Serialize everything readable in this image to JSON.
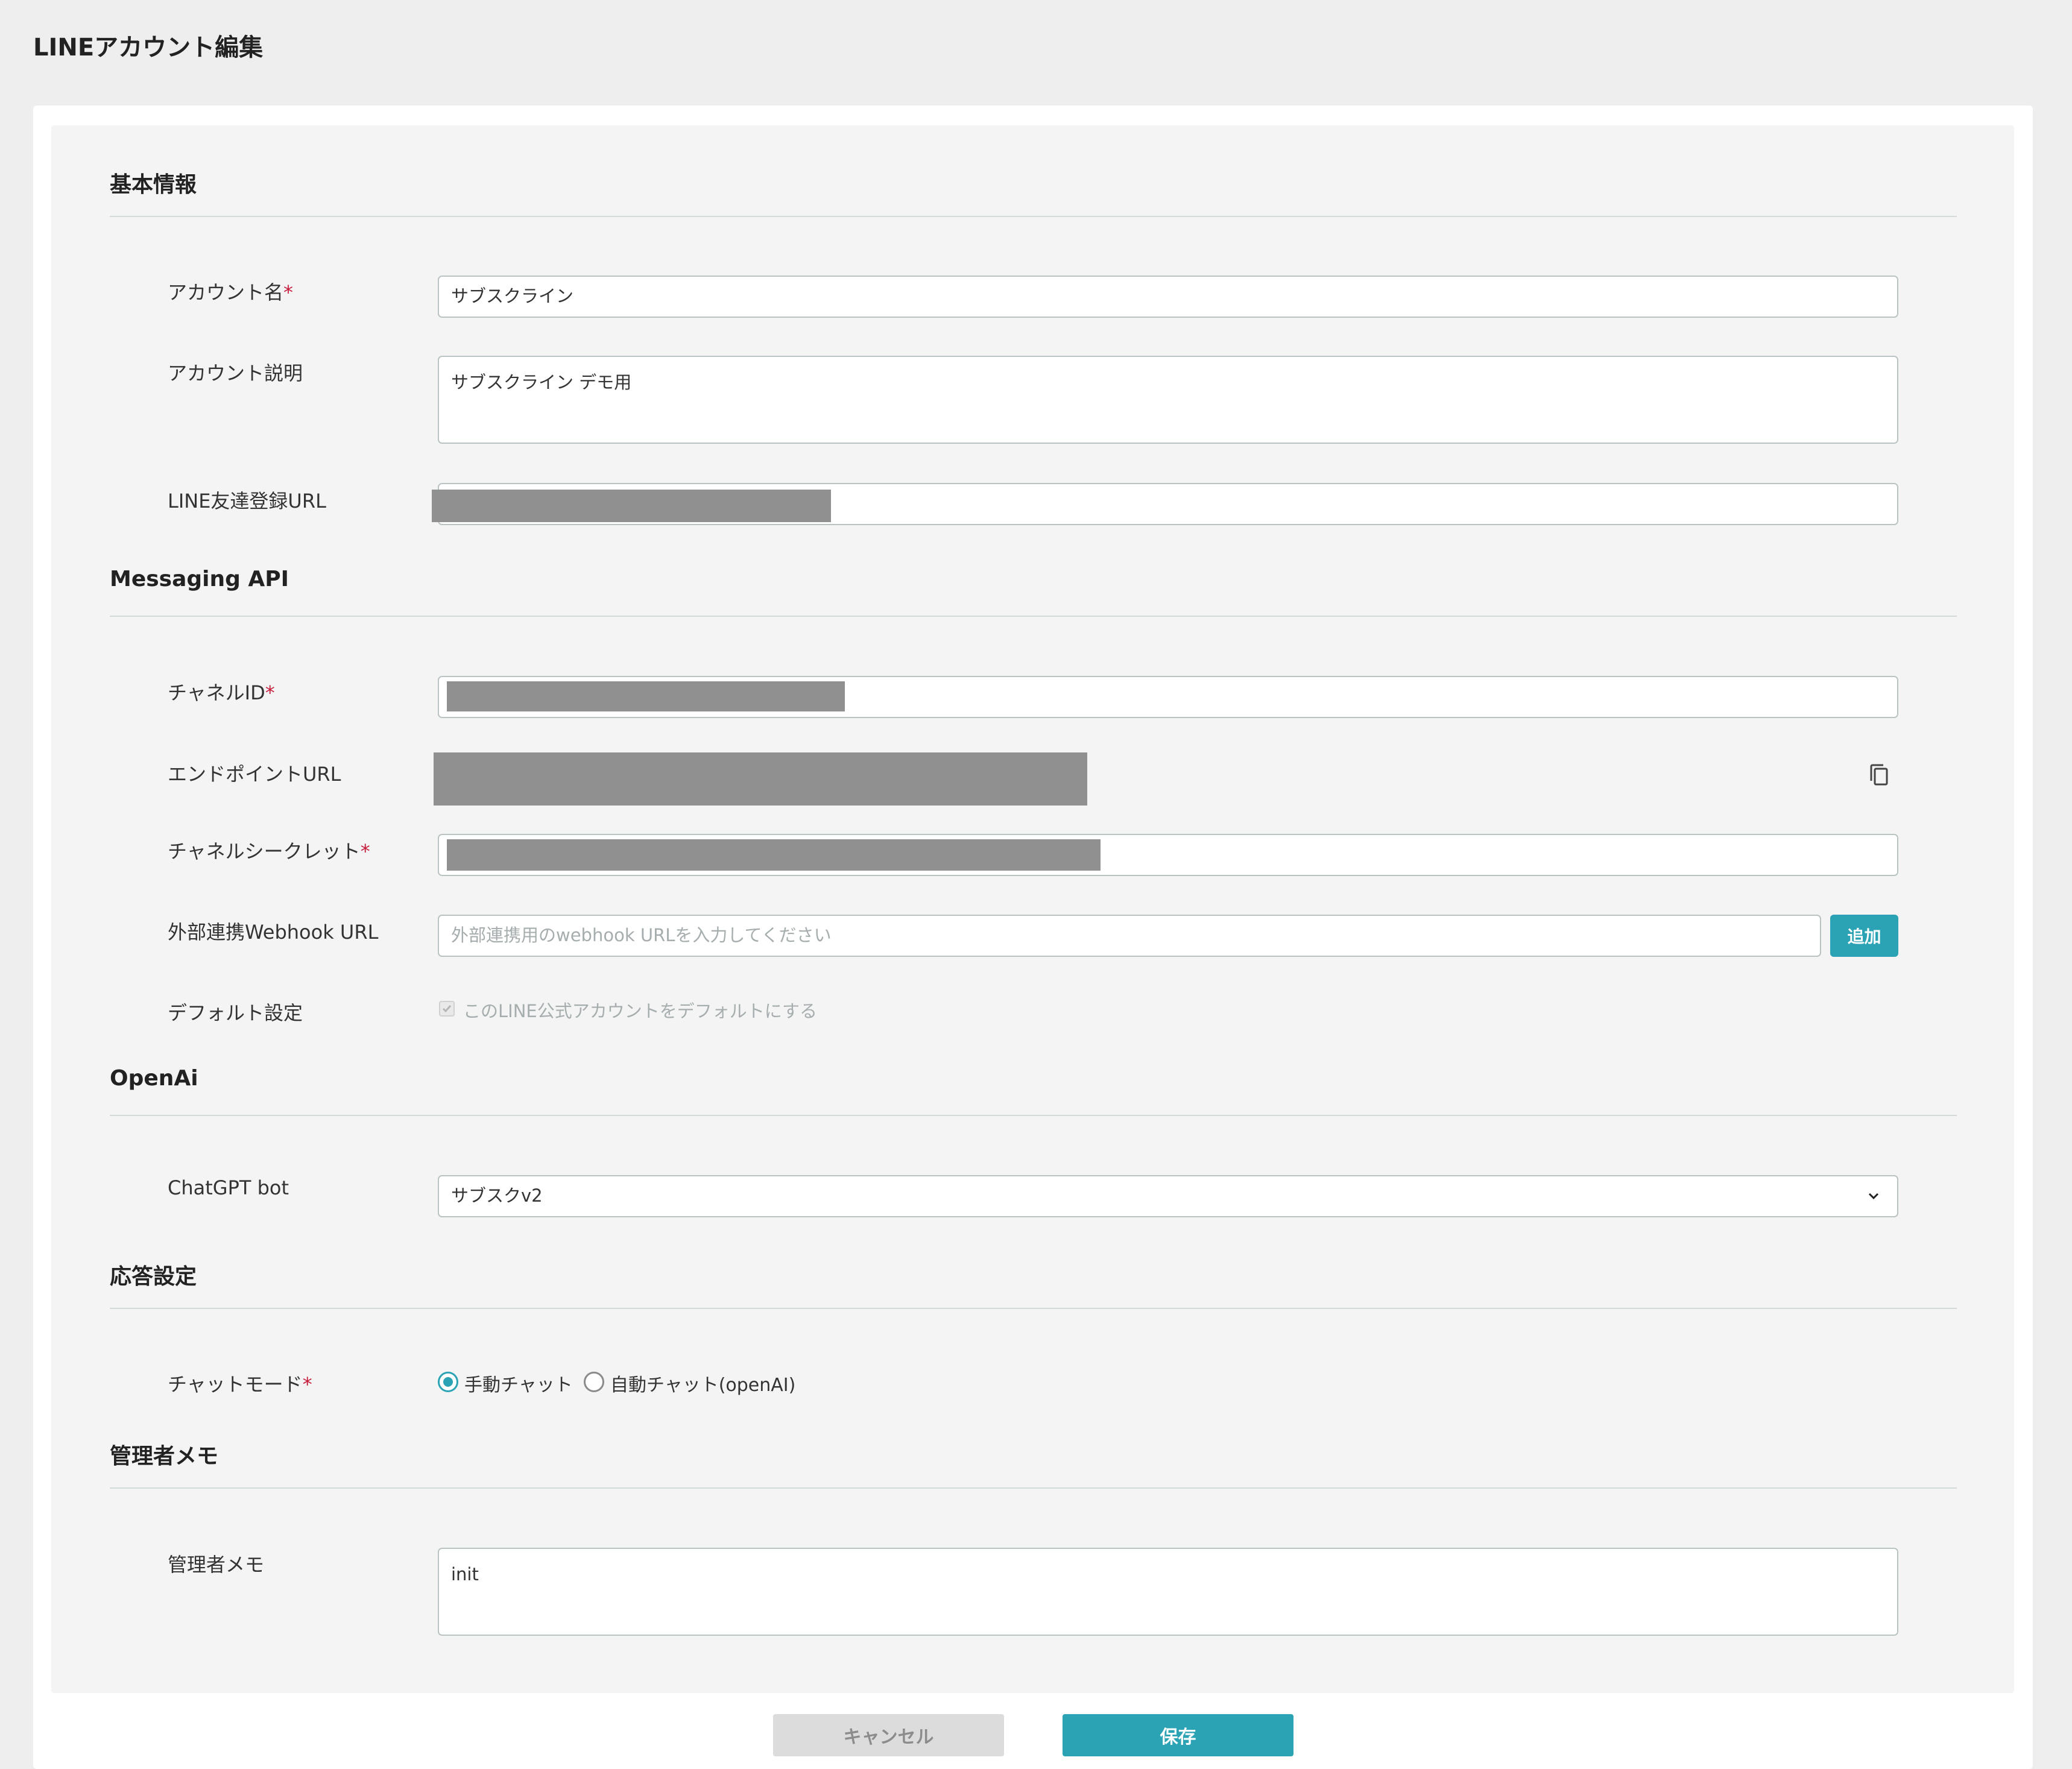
{
  "page": {
    "title": "LINEアカウント編集"
  },
  "basic": {
    "title": "基本情報",
    "account_name": {
      "label": "アカウント名",
      "required": "*",
      "value": "サブスクライン"
    },
    "account_desc": {
      "label": "アカウント説明",
      "value": "サブスクライン デモ用"
    },
    "friend_url": {
      "label": "LINE友達登録URL"
    }
  },
  "messaging": {
    "title": "Messaging API",
    "channel_id": {
      "label": "チャネルID",
      "required": "*"
    },
    "endpoint_url": {
      "label": "エンドポイントURL"
    },
    "channel_secret": {
      "label": "チャネルシークレット",
      "required": "*"
    },
    "webhook": {
      "label": "外部連携Webhook URL",
      "placeholder": "外部連携用のwebhook URLを入力してください",
      "add_label": "追加"
    },
    "default_setting": {
      "label": "デフォルト設定",
      "checkbox_label": "このLINE公式アカウントをデフォルトにする",
      "checked": true
    }
  },
  "openai": {
    "title": "OpenAi",
    "chatgpt_bot": {
      "label": "ChatGPT bot",
      "selected": "サブスクv2"
    }
  },
  "response": {
    "title": "応答設定",
    "chat_mode": {
      "label": "チャットモード",
      "required": "*",
      "options": [
        "手動チャット",
        "自動チャット(openAI)"
      ],
      "selected": "手動チャット"
    }
  },
  "memo": {
    "title": "管理者メモ",
    "admin_memo": {
      "label": "管理者メモ",
      "value": "init"
    }
  },
  "footer": {
    "cancel_label": "キャンセル",
    "save_label": "保存"
  },
  "colors": {
    "accent": "#2ba3b4",
    "required": "#c81e3c",
    "redacted": "#909090",
    "page_bg": "#eeeeee",
    "panel_bg": "#f4f4f4"
  }
}
